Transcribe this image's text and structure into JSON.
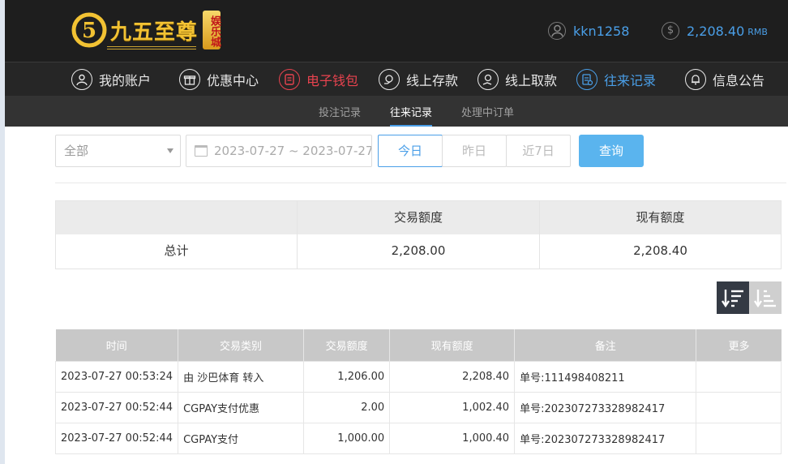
{
  "brand": {
    "logo_glyph": "5",
    "logo_text": "九五至尊",
    "logo_badge": "娱乐城"
  },
  "user": {
    "username": "kkn1258",
    "balance": "2,208.40",
    "balance_unit": "RMB"
  },
  "nav": {
    "items": [
      {
        "label": "我的账户",
        "icon": "user-icon"
      },
      {
        "label": "优惠中心",
        "icon": "gift-icon"
      },
      {
        "label": "电子钱包",
        "icon": "wallet-icon"
      },
      {
        "label": "线上存款",
        "icon": "deposit-icon"
      },
      {
        "label": "线上取款",
        "icon": "withdraw-icon"
      },
      {
        "label": "往来记录",
        "icon": "records-icon"
      },
      {
        "label": "信息公告",
        "icon": "bell-icon"
      }
    ]
  },
  "subnav": {
    "items": [
      "投注记录",
      "往来记录",
      "处理中订单"
    ],
    "active": "往来记录"
  },
  "filters": {
    "type_value": "全部",
    "date_range": "2023-07-27 ~ 2023-07-27",
    "today": "今日",
    "yesterday": "昨日",
    "week": "近7日",
    "query": "查询"
  },
  "summary": {
    "headers": [
      "",
      "交易额度",
      "现有额度"
    ],
    "row": [
      "总计",
      "2,208.00",
      "2,208.40"
    ]
  },
  "records": {
    "headers": [
      "时间",
      "交易类别",
      "交易额度",
      "现有额度",
      "备注",
      "更多"
    ],
    "rows": [
      [
        "2023-07-27 00:53:24",
        "由 沙巴体育 转入",
        "1,206.00",
        "2,208.40",
        "单号:111498408211",
        ""
      ],
      [
        "2023-07-27 00:52:44",
        "CGPAY支付优惠",
        "2.00",
        "1,002.40",
        "单号:202307273328982417",
        ""
      ],
      [
        "2023-07-27 00:52:44",
        "CGPAY支付",
        "1,000.00",
        "1,000.40",
        "单号:202307273328982417",
        ""
      ]
    ]
  },
  "colors": {
    "accent": "#4a9fe8",
    "wallet_red": "#e8434f",
    "logo_gold": "#f2c233",
    "header_bg": "#1e1e1e"
  }
}
